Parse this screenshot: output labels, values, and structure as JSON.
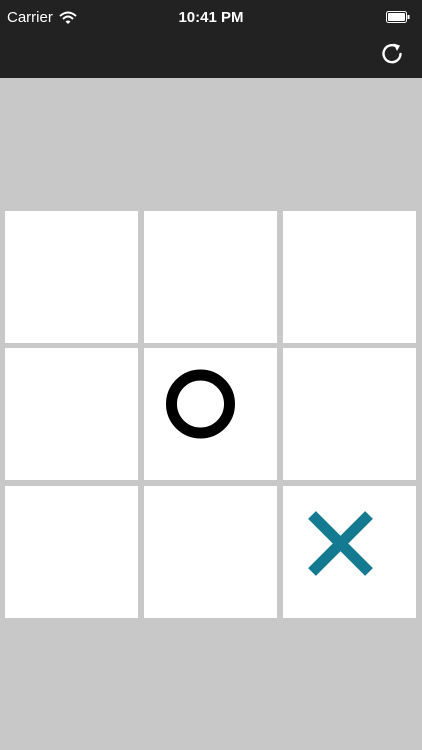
{
  "status_bar": {
    "carrier": "Carrier",
    "time": "10:41 PM",
    "icons": [
      "wifi-icon",
      "battery-icon"
    ]
  },
  "toolbar": {
    "reload_icon": "reload-icon"
  },
  "board": {
    "cells": [
      "",
      "",
      "",
      "",
      "O",
      "",
      "",
      "",
      "X"
    ]
  },
  "colors": {
    "o_mark": "#000000",
    "x_mark": "#137a91",
    "cell_bg": "#ffffff",
    "board_bg": "#c8c8c8",
    "topbar_bg": "#222222"
  }
}
